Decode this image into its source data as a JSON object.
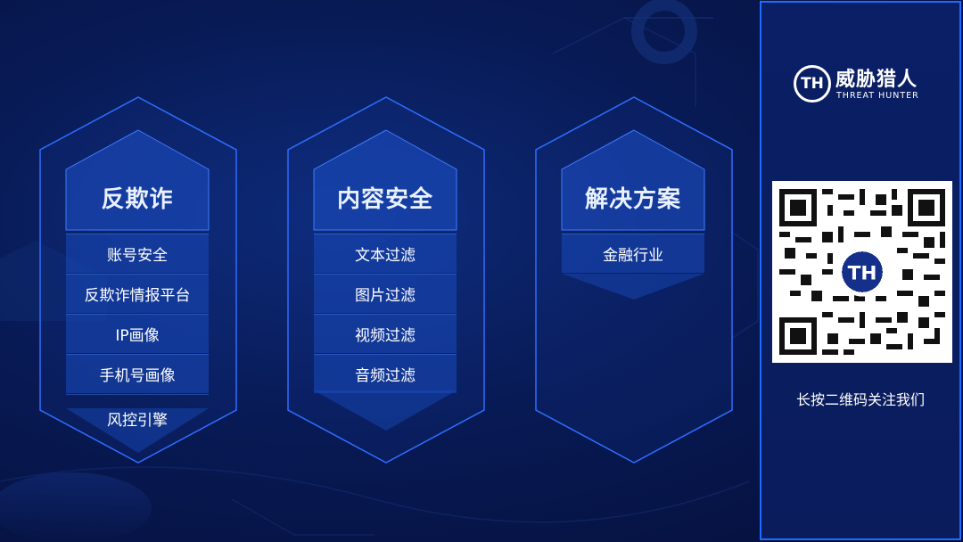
{
  "panels": [
    {
      "title": "反欺诈",
      "items": [
        "账号安全",
        "反欺诈情报平台",
        "IP画像",
        "手机号画像",
        "风控引擎"
      ]
    },
    {
      "title": "内容安全",
      "items": [
        "文本过滤",
        "图片过滤",
        "视频过滤",
        "音频过滤"
      ]
    },
    {
      "title": "解决方案",
      "items": [
        "金融行业"
      ]
    }
  ],
  "brand": {
    "mark": "TH",
    "name_cn": "威胁猎人",
    "name_en": "THREAT HUNTER"
  },
  "qr_caption": "长按二维码关注我们",
  "colors": {
    "background": "#081a55",
    "accent": "#1f6bff",
    "panel_fill": "#194bbe"
  }
}
